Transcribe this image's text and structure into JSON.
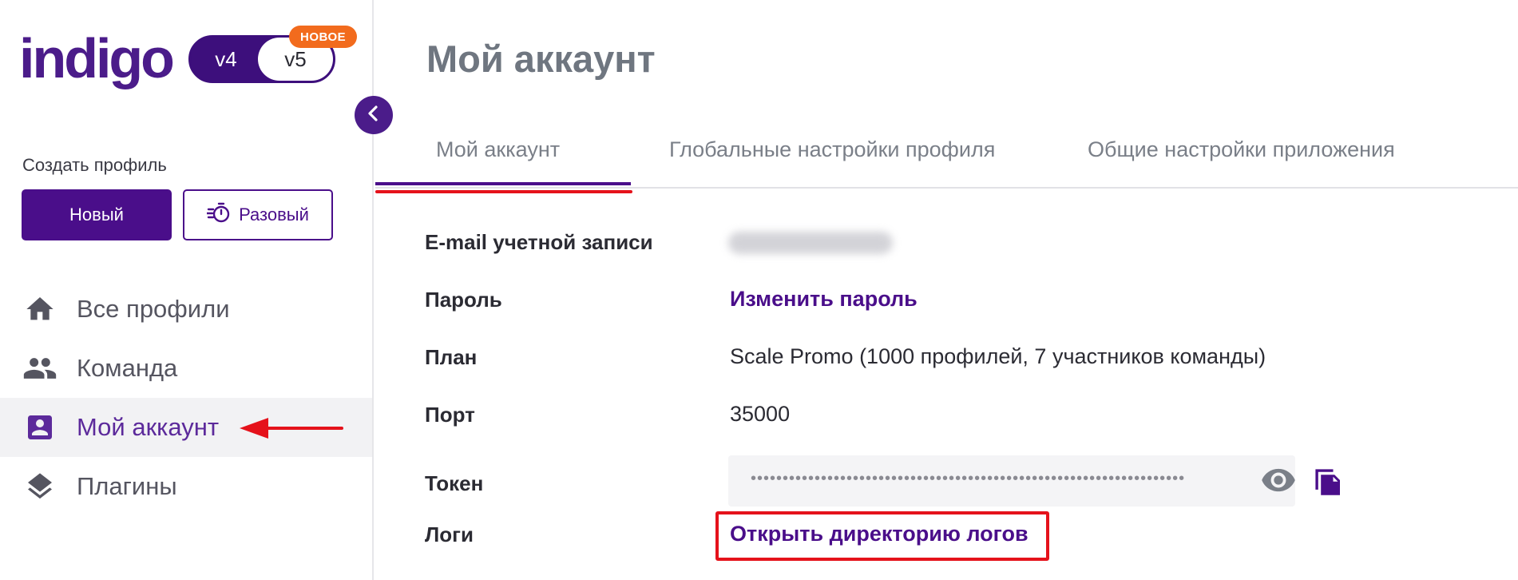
{
  "brand": {
    "logo_text": "indigo",
    "version_left": "v4",
    "version_right": "v5",
    "new_badge": "НОВОЕ",
    "logo_color": "#4b1c8a",
    "accent": "#f26b1d"
  },
  "sidebar": {
    "create_label": "Создать профиль",
    "btn_new": "Новый",
    "btn_once": "Разовый",
    "items": [
      {
        "label": "Все профили",
        "icon": "home-icon",
        "active": false
      },
      {
        "label": "Команда",
        "icon": "team-icon",
        "active": false
      },
      {
        "label": "Мой аккаунт",
        "icon": "account-icon",
        "active": true
      },
      {
        "label": "Плагины",
        "icon": "layers-icon",
        "active": false
      }
    ]
  },
  "main": {
    "title": "Мой аккаунт",
    "tabs": [
      {
        "label": "Мой аккаунт",
        "active": true
      },
      {
        "label": "Глобальные настройки профиля",
        "active": false
      },
      {
        "label": "Общие настройки приложения",
        "active": false
      }
    ],
    "rows": {
      "email_label": "E-mail учетной записи",
      "password_label": "Пароль",
      "password_link": "Изменить пароль",
      "plan_label": "План",
      "plan_value": "Scale Promo (1000 профилей, 7 участников команды)",
      "port_label": "Порт",
      "port_value": "35000",
      "token_label": "Токен",
      "token_mask": "••••••••••••••••••••••••••••••••••••••••••••••••••••••••••••••••••••",
      "logs_label": "Логи",
      "logs_link": "Открыть директорию логов"
    }
  },
  "colors": {
    "primary": "#4a0e8a",
    "highlight_red": "#e5121b",
    "nav_active_bg": "#f2f2f4"
  }
}
